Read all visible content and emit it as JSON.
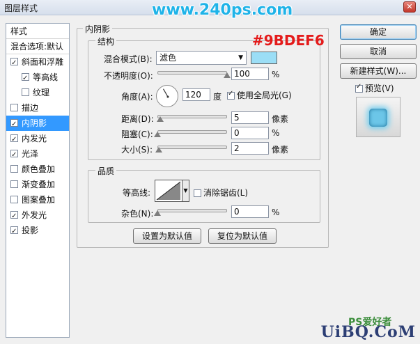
{
  "window": {
    "title": "图层样式",
    "close": "✕"
  },
  "watermark_top": "www.240ps.com",
  "color_note": "#9BDEF6",
  "style_list": {
    "header": "样式",
    "blend_default": "混合选项:默认",
    "items": [
      {
        "label": "斜面和浮雕",
        "checked": true,
        "indent": false
      },
      {
        "label": "等高线",
        "checked": true,
        "indent": true
      },
      {
        "label": "纹理",
        "checked": false,
        "indent": true
      },
      {
        "label": "描边",
        "checked": false,
        "indent": false
      },
      {
        "label": "内阴影",
        "checked": true,
        "indent": false,
        "selected": true
      },
      {
        "label": "内发光",
        "checked": true,
        "indent": false
      },
      {
        "label": "光泽",
        "checked": true,
        "indent": false
      },
      {
        "label": "颜色叠加",
        "checked": false,
        "indent": false
      },
      {
        "label": "渐变叠加",
        "checked": false,
        "indent": false
      },
      {
        "label": "图案叠加",
        "checked": false,
        "indent": false
      },
      {
        "label": "外发光",
        "checked": true,
        "indent": false
      },
      {
        "label": "投影",
        "checked": true,
        "indent": false
      }
    ]
  },
  "panel": {
    "title": "内阴影",
    "structure": {
      "title": "结构",
      "blend_mode_label": "混合模式(B):",
      "blend_mode_value": "滤色",
      "swatch_color": "#9bdef6",
      "opacity_label": "不透明度(O):",
      "opacity_value": "100",
      "opacity_unit": "%",
      "opacity_fraction": 1.0,
      "angle_label": "角度(A):",
      "angle_value": "120",
      "angle_unit": "度",
      "global_light_label": "使用全局光(G)",
      "global_light_checked": true,
      "distance_label": "距离(D):",
      "distance_value": "5",
      "distance_unit": "像素",
      "choke_label": "阻塞(C):",
      "choke_value": "0",
      "choke_unit": "%",
      "size_label": "大小(S):",
      "size_value": "2",
      "size_unit": "像素"
    },
    "quality": {
      "title": "品质",
      "contour_label": "等高线:",
      "antialias_label": "消除锯齿(L)",
      "antialias_checked": false,
      "noise_label": "杂色(N):",
      "noise_value": "0",
      "noise_unit": "%"
    },
    "make_default": "设置为默认值",
    "reset_default": "复位为默认值"
  },
  "buttons": {
    "ok": "确定",
    "cancel": "取消",
    "new_style": "新建样式(W)...",
    "preview_label": "预览(V)",
    "preview_checked": true
  },
  "bottom_watermark": "UiBQ.CoM",
  "bottom_watermark_small": "PS爱好者"
}
